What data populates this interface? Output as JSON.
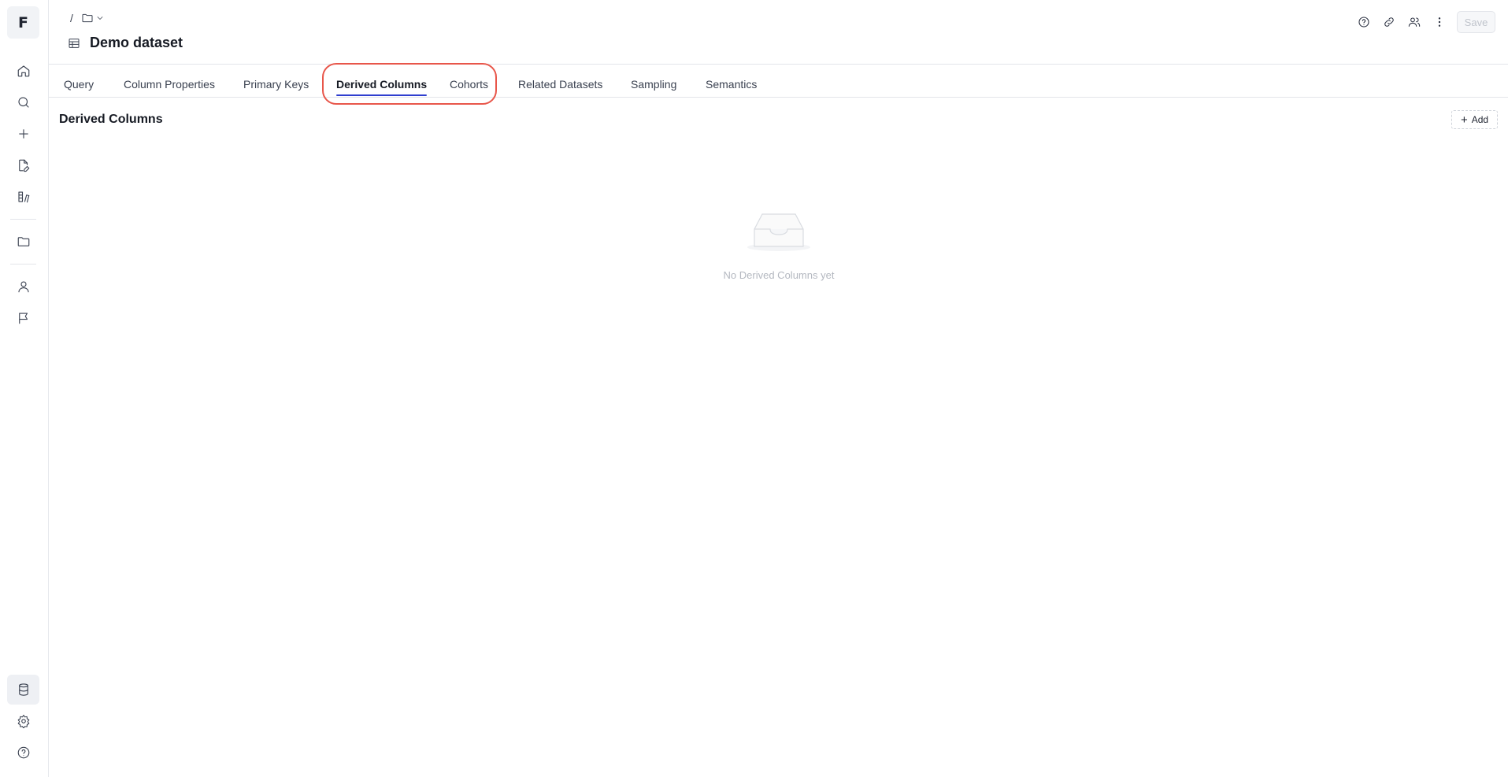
{
  "app": {
    "logo_letter": "F"
  },
  "sidebar": {
    "items": [
      {
        "name": "home-icon"
      },
      {
        "name": "search-icon"
      },
      {
        "name": "plus-icon"
      },
      {
        "name": "file-edit-icon"
      },
      {
        "name": "lab-icon"
      },
      {
        "name": "folder-icon"
      },
      {
        "name": "user-icon"
      },
      {
        "name": "flag-icon"
      },
      {
        "name": "database-icon",
        "active": true
      },
      {
        "name": "gear-icon"
      },
      {
        "name": "help-icon"
      }
    ]
  },
  "breadcrumb": {
    "separator": "/"
  },
  "header": {
    "title": "Demo dataset",
    "save_label": "Save"
  },
  "tabs": [
    {
      "label": "Query"
    },
    {
      "label": "Column Properties"
    },
    {
      "label": "Primary Keys"
    },
    {
      "label": "Derived Columns",
      "active": true
    },
    {
      "label": "Cohorts"
    },
    {
      "label": "Related Datasets"
    },
    {
      "label": "Sampling"
    },
    {
      "label": "Semantics"
    }
  ],
  "main": {
    "section_title": "Derived Columns",
    "add_label": "Add",
    "empty_text": "No Derived Columns yet"
  },
  "colors": {
    "accent": "#2f3ecf",
    "highlight": "#e8564a"
  }
}
